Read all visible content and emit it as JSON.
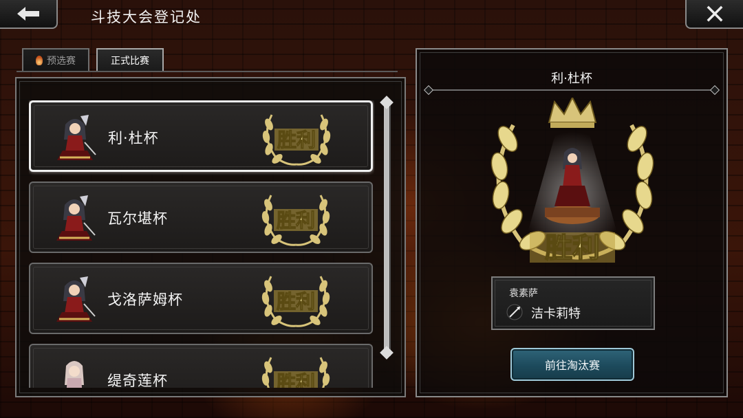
{
  "header": {
    "title": "斗技大会登记处"
  },
  "tabs": [
    {
      "label": "预选赛",
      "active": false
    },
    {
      "label": "正式比赛",
      "active": true
    }
  ],
  "cups": [
    {
      "name": "利·杜杯",
      "badge": "胜利",
      "selected": true,
      "avatar": "red-dress-dancer"
    },
    {
      "name": "瓦尔堪杯",
      "badge": "胜利",
      "selected": false,
      "avatar": "red-dress-dancer"
    },
    {
      "name": "戈洛萨姆杯",
      "badge": "胜利",
      "selected": false,
      "avatar": "red-dress-dancer"
    },
    {
      "name": "缇奇莲杯",
      "badge": "胜利",
      "selected": false,
      "avatar": "pale-hair-dancer"
    }
  ],
  "detail": {
    "title": "利·杜杯",
    "trophy_label": "胜利",
    "job": "袁素萨",
    "character": "洁卡莉特",
    "weapon_icon": "spear-icon",
    "button_label": "前往淘汰赛"
  },
  "colors": {
    "gold": "#d8c47a",
    "button": "#1d4a5c",
    "frame": "#8a8a8a"
  }
}
